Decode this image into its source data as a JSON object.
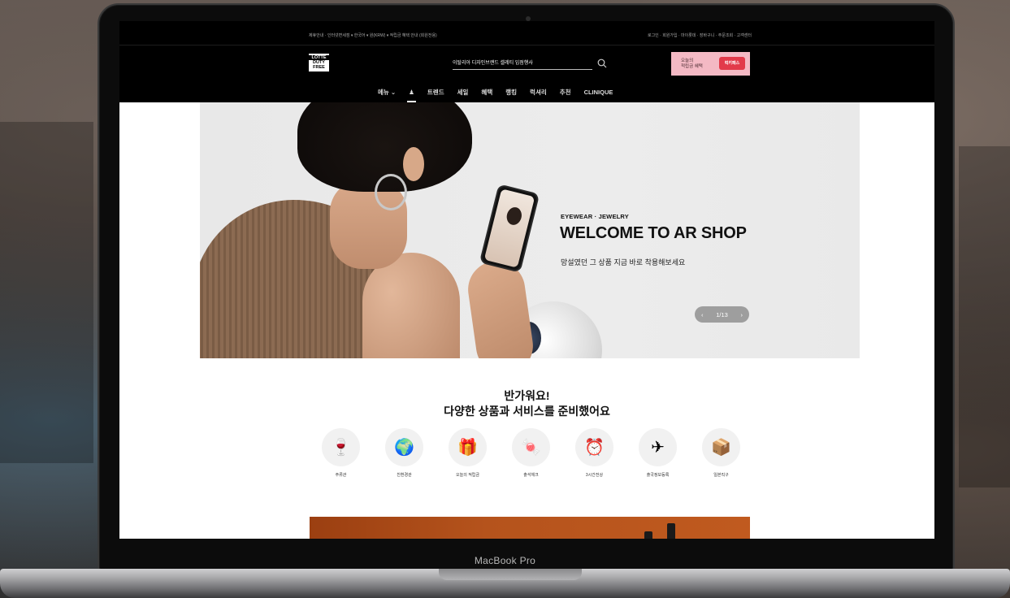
{
  "util": {
    "left": "제휴안내 · 인터넷면세점 ▾    한국어 ▾    원(KRW) ▾    적립금 혜택 안내 (회원전용)",
    "right": "로그인 · 회원가입 · 마이롯데 · 장바구니 · 주문조회 · 고객센터"
  },
  "logo": {
    "line1": "LOTTE",
    "line2": "DUTY",
    "line3": "FREE"
  },
  "search": {
    "value": "이탈리아 디자인브랜드 셀레티 입점행사"
  },
  "promo": {
    "line1": "오늘의",
    "line2": "적립금 혜택",
    "badge": "럭키패스"
  },
  "nav": {
    "items": [
      "메뉴 ⌄",
      "♟",
      "트렌드",
      "세일",
      "혜택",
      "랭킹",
      "럭셔리",
      "추천",
      "CLINIQUE"
    ]
  },
  "hero": {
    "eyebrow": "EYEWEAR · JEWELRY",
    "title": "WELCOME TO AR SHOP",
    "subtitle": "망설였던 그 상품 지금 바로 착용해보세요",
    "pager_prev": "‹",
    "pager_text": "1/13",
    "pager_next": "›"
  },
  "welcome": {
    "line1": "반가워요!",
    "line2": "다양한 상품과 서비스를 준비했어요"
  },
  "services": [
    {
      "label": "주류관",
      "icon": "🍷"
    },
    {
      "label": "친환경관",
      "icon": "🌍"
    },
    {
      "label": "오늘의 적립금",
      "icon": "🎁"
    },
    {
      "label": "출석체크",
      "icon": "🍬"
    },
    {
      "label": "3시간전상",
      "icon": "⏰"
    },
    {
      "label": "출국정보등록",
      "icon": "✈"
    },
    {
      "label": "일본직구",
      "icon": "📦"
    }
  ],
  "device": {
    "label": "MacBook Pro"
  }
}
